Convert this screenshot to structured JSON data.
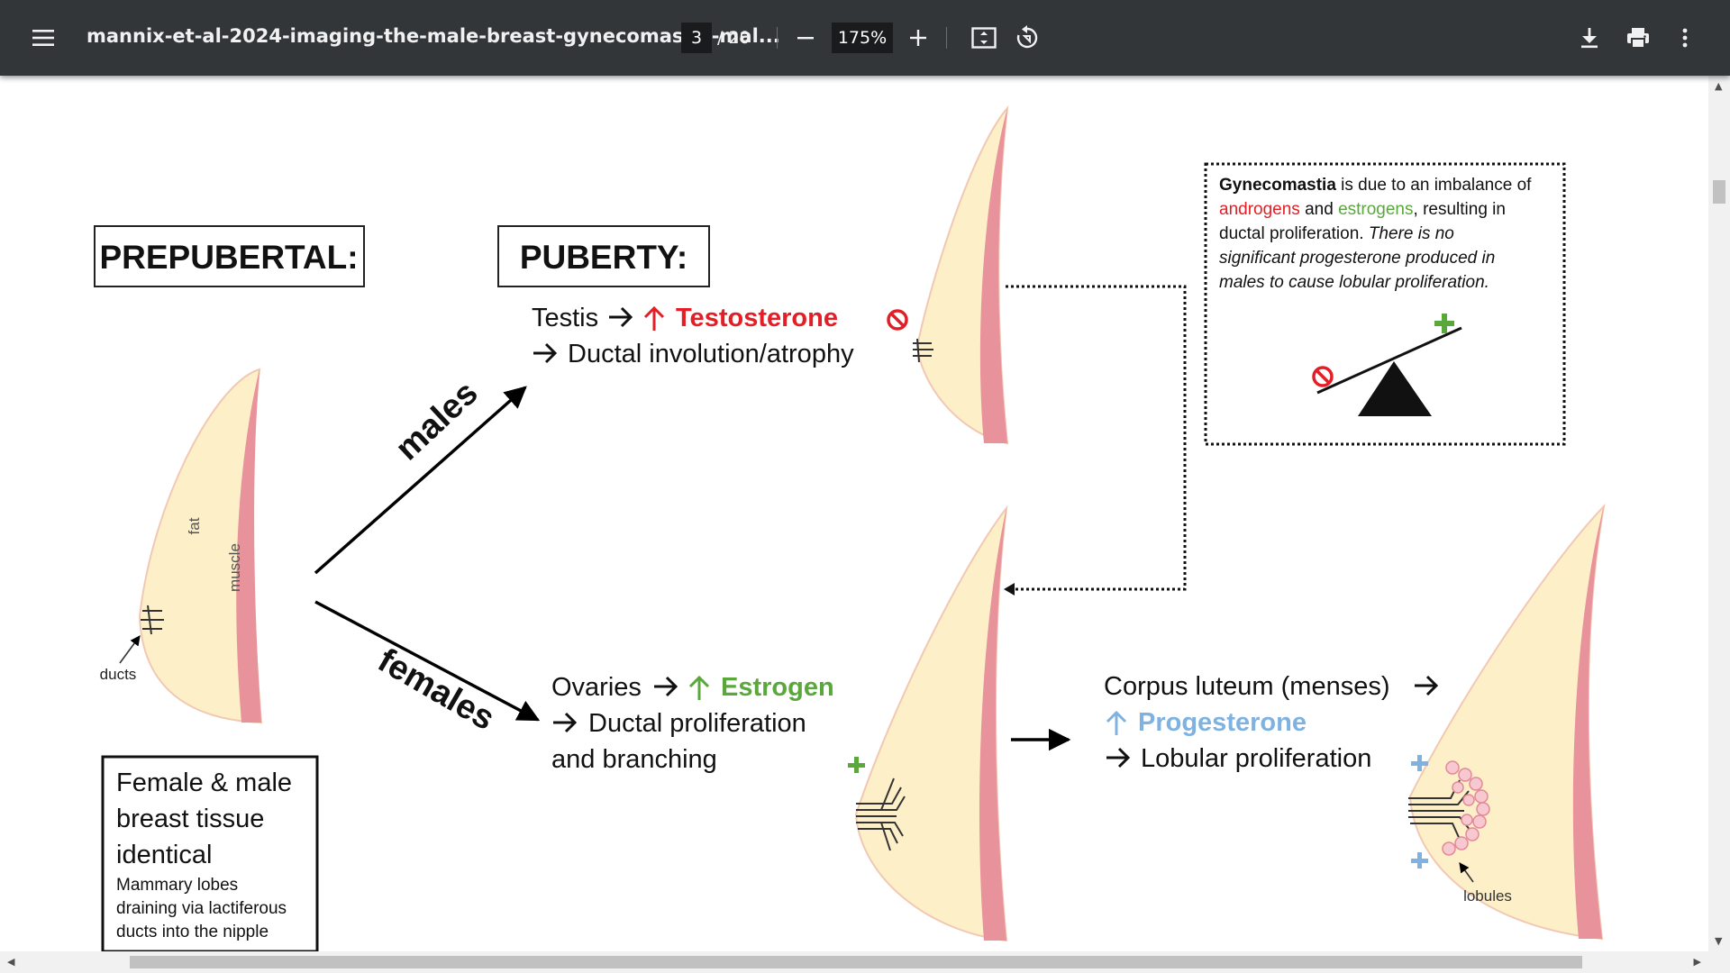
{
  "toolbar": {
    "title": "mannix-et-al-2024-imaging-the-male-breast-gynecomastia-mal...",
    "page_current": "3",
    "page_total": "/ 20",
    "zoom": "175%",
    "icons": [
      "menu-icon",
      "zoom-out-icon",
      "zoom-in-icon",
      "fit-page-icon",
      "rotate-icon",
      "download-icon",
      "print-icon",
      "more-options-icon"
    ]
  },
  "figure": {
    "prepubertal_heading": "PREPUBERTAL:",
    "puberty_heading": "PUBERTY:",
    "label_fat": "fat",
    "label_muscle": "muscle",
    "label_ducts": "ducts",
    "label_males": "males",
    "label_females": "females",
    "testis_prefix": "Testis",
    "testosterone": "Testosterone",
    "ductal_involution": "Ductal involution/atrophy",
    "ovaries_prefix": "Ovaries",
    "estrogen": "Estrogen",
    "ductal_proliferation": "Ductal proliferation",
    "and_branching": "and branching",
    "corpus_luteum": "Corpus luteum (menses)",
    "progesterone": "Progesterone",
    "lobular_proliferation": "Lobular proliferation",
    "label_lobules": "lobules",
    "box_identical": {
      "line1": "Female & male",
      "line2": "breast tissue",
      "line3": "identical",
      "sub1": "Mammary lobes",
      "sub2": "draining via lactiferous",
      "sub3": "ducts into the nipple"
    },
    "gyno_box": {
      "l1_bold": "Gynecomastia",
      "l1_rest": " is due to an imbalance of",
      "l2_androgens": "androgens",
      "l2_and": " and ",
      "l2_estrogens": "estrogens",
      "l2_rest": ", resulting in",
      "l3_normal": "ductal proliferation. ",
      "l3_italic": "There is no",
      "l4": "significant progesterone produced in",
      "l5": "males to cause lobular proliferation."
    },
    "colors": {
      "red": "#e41e26",
      "green": "#5aa83c",
      "blue": "#7fb2e0",
      "fat": "#fdefc8",
      "muscle": "#e8939b"
    }
  }
}
